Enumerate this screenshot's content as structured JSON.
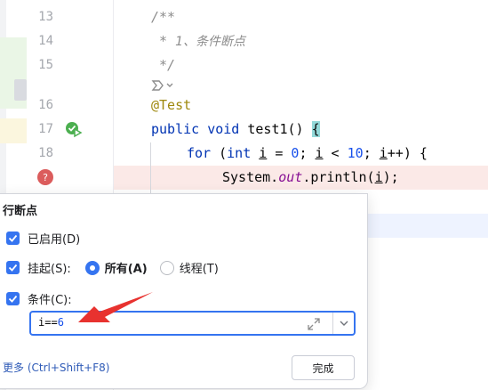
{
  "editor": {
    "line_numbers": [
      "13",
      "14",
      "15",
      "16",
      "17",
      "18"
    ],
    "lines": {
      "l13": "/**",
      "l14_star": " * ",
      "l14_text": "1、条件断点",
      "l15": " */",
      "l16": "@Test",
      "l17_kw1": "public",
      "l17_kw2": "void",
      "l17_name": " test1() ",
      "l17_brace": "{",
      "l18_kw": "for",
      "l18_p1": " (",
      "l18_int": "int",
      "l18_i1": "i",
      "l18_eq": " = ",
      "l18_zero": "0",
      "l18_semi1": "; ",
      "l18_i2": "i",
      "l18_lt": " < ",
      "l18_ten": "10",
      "l18_semi2": "; ",
      "l18_i3": "i",
      "l18_end": "++) {",
      "l19_sys": "System.",
      "l19_out": "out",
      "l19_print": ".println(",
      "l19_i": "i",
      "l19_end": ");"
    },
    "colors": {
      "keyword": "#0033b3",
      "number": "#1750eb",
      "annotation": "#9e880d",
      "field": "#871094",
      "breakpoint": "#db5c5c",
      "run": "#4caf50"
    }
  },
  "popup": {
    "title": "行断点",
    "enabled_label": "已启用(D)",
    "enabled_checked": true,
    "suspend_label": "挂起(S):",
    "suspend_checked": true,
    "suspend_all_label": "所有(A)",
    "suspend_thread_label": "线程(T)",
    "suspend_selected": "所有(A)",
    "condition_label": "条件(C):",
    "condition_checked": true,
    "condition_prefix": "i==",
    "condition_value": "6",
    "more_link": "更多 (Ctrl+Shift+F8)",
    "done_button": "完成",
    "accent": "#3574f0"
  }
}
